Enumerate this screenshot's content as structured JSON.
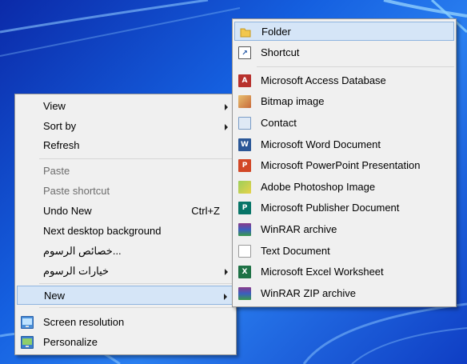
{
  "context_menu": {
    "items": [
      {
        "label": "View",
        "submenu": true
      },
      {
        "label": "Sort by",
        "submenu": true
      },
      {
        "label": "Refresh"
      },
      {
        "label": "Paste",
        "disabled": true
      },
      {
        "label": "Paste shortcut",
        "disabled": true
      },
      {
        "label": "Undo New",
        "shortcut": "Ctrl+Z"
      },
      {
        "label": "Next desktop background"
      },
      {
        "label": "...خصائص الرسوم"
      },
      {
        "label": "خيارات الرسوم",
        "submenu": true
      },
      {
        "label": "New",
        "submenu": true,
        "highlighted": true
      },
      {
        "label": "Screen resolution",
        "icon": "screen-resolution-icon"
      },
      {
        "label": "Personalize",
        "icon": "personalize-icon"
      }
    ]
  },
  "new_submenu": {
    "items": [
      {
        "label": "Folder",
        "icon": "folder-icon",
        "highlighted": true
      },
      {
        "label": "Shortcut",
        "icon": "shortcut-icon"
      },
      {
        "label": "Microsoft Access Database",
        "icon": "access-icon"
      },
      {
        "label": "Bitmap image",
        "icon": "bitmap-icon"
      },
      {
        "label": "Contact",
        "icon": "contact-icon"
      },
      {
        "label": "Microsoft Word Document",
        "icon": "word-icon"
      },
      {
        "label": "Microsoft PowerPoint Presentation",
        "icon": "powerpoint-icon"
      },
      {
        "label": "Adobe Photoshop Image",
        "icon": "photoshop-icon"
      },
      {
        "label": "Microsoft Publisher Document",
        "icon": "publisher-icon"
      },
      {
        "label": "WinRAR archive",
        "icon": "winrar-icon"
      },
      {
        "label": "Text Document",
        "icon": "text-document-icon"
      },
      {
        "label": "Microsoft Excel Worksheet",
        "icon": "excel-icon"
      },
      {
        "label": "WinRAR ZIP archive",
        "icon": "winrar-zip-icon"
      }
    ]
  },
  "colors": {
    "menu_background": "#f0f0f0",
    "highlight": "#d5e5f7",
    "highlight_border": "#8fb4e0",
    "disabled_text": "#6d6d6d",
    "desktop_blue": "#1560e0"
  }
}
